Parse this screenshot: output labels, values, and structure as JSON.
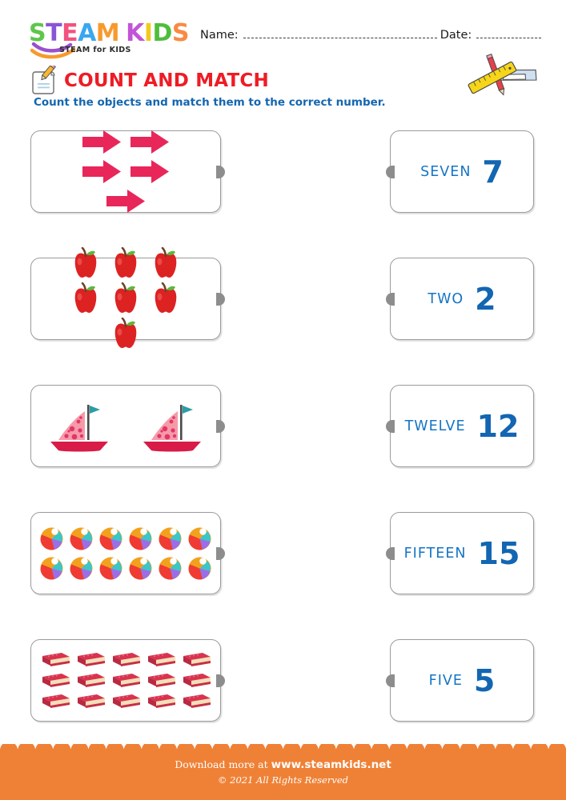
{
  "brand": {
    "logo_letters": [
      {
        "char": "S",
        "color": "#5ec64a"
      },
      {
        "char": "T",
        "color": "#8a54d8"
      },
      {
        "char": "E",
        "color": "#f2527f"
      },
      {
        "char": "A",
        "color": "#3aa8f0"
      },
      {
        "char": "M",
        "color": "#f79a2e"
      },
      {
        "char": "K",
        "color": "#c254d8"
      },
      {
        "char": "I",
        "color": "#f4c81e"
      },
      {
        "char": "D",
        "color": "#4fbd3c"
      },
      {
        "char": "S",
        "color": "#f88a44"
      }
    ],
    "tagline": "STEAM for KIDS",
    "swoosh_colors": [
      "#9a4fd0",
      "#f79a2e"
    ]
  },
  "header": {
    "name_label": "Name:",
    "date_label": "Date:",
    "title": "COUNT AND MATCH",
    "title_color": "#ee1c25",
    "subtitle": "Count the objects and match them to the correct number.",
    "subtitle_color": "#1466b0",
    "scroll_icon": "scroll-pencil-icon",
    "tools_icon": "ruler-pencil-triangle-icon"
  },
  "rows": [
    {
      "object": "arrow",
      "object_label": "arrows",
      "count": 5,
      "layout": [
        2,
        2,
        1
      ],
      "answer_word": "SEVEN",
      "answer_number": "7"
    },
    {
      "object": "apple",
      "object_label": "apples",
      "count": 7,
      "layout": [
        3,
        3,
        1
      ],
      "answer_word": "TWO",
      "answer_number": "2"
    },
    {
      "object": "boat",
      "object_label": "sailboats",
      "count": 2,
      "layout": [
        2
      ],
      "answer_word": "TWELVE",
      "answer_number": "12"
    },
    {
      "object": "ball",
      "object_label": "beach balls",
      "count": 12,
      "layout": [
        6,
        6
      ],
      "answer_word": "FIFTEEN",
      "answer_number": "15"
    },
    {
      "object": "book",
      "object_label": "books",
      "count": 15,
      "layout": [
        5,
        5,
        5
      ],
      "answer_word": "FIVE",
      "answer_number": "5"
    }
  ],
  "colors": {
    "answer_word": "#1575c4",
    "answer_number": "#1266b2",
    "box_border": "#9b9b9b",
    "knob": "#8d8d8d",
    "arrow": "#e8265a",
    "apple": "#dd2222",
    "boat_sail": "#f79aa8",
    "boat_hull": "#d81b47",
    "book": "#d9334f",
    "footer_band": "#ef8136"
  },
  "footer": {
    "line1_prefix": "Download more at",
    "line1_site": "www.steamkids.net",
    "line2": "© 2021 All Rights Reserved"
  }
}
